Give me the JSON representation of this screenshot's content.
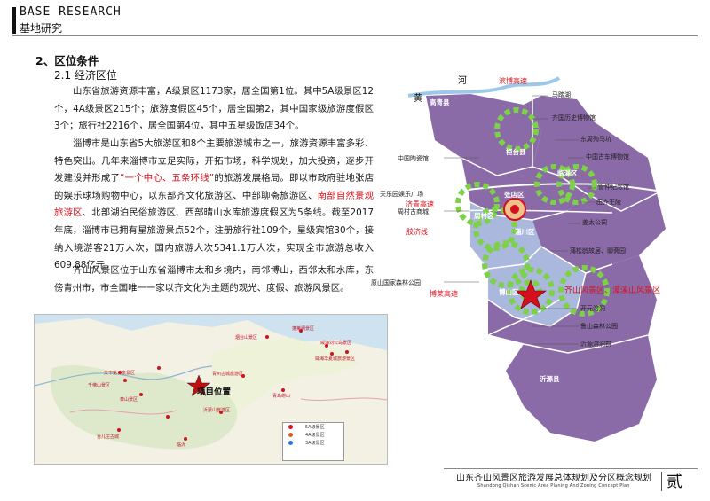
{
  "header": {
    "title": "BASE RESEARCH",
    "subtitle": "基地研究"
  },
  "section": {
    "title": "2、区位条件",
    "subtitle": "2.1  经济区位"
  },
  "paragraphs": {
    "p1": "山东省旅游资源丰富，A级景区1173家，居全国第1位。其中5A级景区12个，4A级景区215个；旅游度假区45个，居全国第2，其中国家级旅游度假区3个；旅行社2216个，居全国第4位，其中五星级饭店34个。",
    "p2_a": "淄博市是山东省5大旅游区和8个主要旅游城市之一，旅游资源丰富多彩、特色突出。几年来淄博市立足实际，开拓市场，科学规划，加大投资，逐步开发建设并形成了",
    "p2_red1": "“一个中心、五条环线”",
    "p2_b": "的旅游发展格局。即以市政府驻地张店的娱乐球场购物中心，以东部齐文化旅游区、中部聊斋旅游区、",
    "p2_red2": "南部自然景观旅游区",
    "p2_c": "、北部湖泊民俗旅游区、西部晴山水库旅游度假区为5条线。截至2017年底，淄博市已拥有星旅游景点52个，注册旅行社109个，星级宾馆30个，接纳入境游客21万人次，国内旅游人次5341.1万人次，实现全市旅游总收入609.88亿元。",
    "p3": "齐山风景区位于山东省淄博市太和乡境内，南邻博山，西邻太和水库，东傍青州市，市全国唯一一家以齐文化为主题的观光、度假、旅游风景区。"
  },
  "inset_map": {
    "project_label": "项目位置",
    "places": [
      "烟台山景区",
      "蓬莱阁景区",
      "威海刘公岛景区",
      "威海华夏城旅游景区",
      "天下第一泉景区",
      "千佛山景区",
      "青州古城旅游区",
      "泰山景区",
      "沂蒙山旅游区",
      "台儿庄古城",
      "临沂",
      "青岛崂山"
    ],
    "legend": [
      "5A级景区",
      "4A级景区",
      "3A级景区"
    ],
    "colors": {
      "spot": "#d4101c",
      "land": "#f3f1e4",
      "sea": "#cfe2ef"
    }
  },
  "big_map": {
    "rivers": [
      "黄",
      "河"
    ],
    "roads": [
      "滨博高速",
      "济青高速",
      "胶济线",
      "博莱高速"
    ],
    "counties": [
      "高青县",
      "桓台县",
      "临淄区",
      "张店区",
      "周村区",
      "淄川区",
      "博山区",
      "沂源县"
    ],
    "labels_right": [
      "马踏湖",
      "齐国历史博物馆",
      "东周殉马坑",
      "中国古车博物馆",
      "管仲纪念馆",
      "田齐王陵",
      "姜太公祠",
      "蒲松龄故居、聊斋园",
      "开元溶洞",
      "鲁山森林公园",
      "沂源溶洞群"
    ],
    "labels_left": [
      "中国陶瓷馆",
      "天乐园娱乐广场",
      "周村古商城",
      "原山国家森林公园"
    ],
    "scenic_label": "齐山风景区、潭溪山风景区",
    "colors": {
      "purple": "#8b6aa8",
      "blue": "#a9b8dc",
      "green": "#7cd146",
      "red": "#d4101c"
    }
  },
  "footer": {
    "title": "山东齐山风景区旅游发展总体规划及分区概念规划",
    "subtitle_en": "Shandong Qishan Scenic Area Planing And Zoning Concept Plan",
    "page_number": "贰"
  }
}
